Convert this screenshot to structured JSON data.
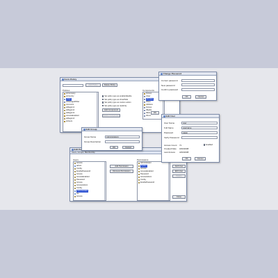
{
  "form_policy": {
    "title": "Form Policy",
    "buttons": {
      "add_policy": "Add Policy",
      "delete_policy": "Delete Policy",
      "add_component": "Add Component",
      "delete_component": "Delete Component",
      "ok": "OK",
      "cancel": "Cancel"
    },
    "policies_label": "Policies",
    "components_label": "Components",
    "policies": [
      "ieCompany",
      "ieCountry",
      "Users",
      "ieManagedFilter",
      "Accounts",
      "ieRegion1",
      "ieRegion2",
      "ieRegion3",
      "AccessEnabled",
      "ieRegion4",
      "ieUsers"
    ],
    "components": [
      "tGroup",
      "tUser",
      "tAccess",
      "tPass",
      "Address",
      "tGroup",
      "tRights",
      "tRole",
      "tPerm"
    ],
    "checkboxes": [
      "Set policy type as enable/disable",
      "Set policy type as show/hide",
      "Set policy type as custom action",
      "Set policy type as readonly"
    ]
  },
  "change_password": {
    "title": "Change Password",
    "fields": [
      "Current password",
      "New password",
      "Confirm password"
    ],
    "buttons": {
      "ok": "OK",
      "cancel": "Cancel"
    }
  },
  "edit_user": {
    "title": "Edit User",
    "labels": {
      "user_name": "User Name",
      "full_name": "Full Name",
      "password": "Password",
      "verify_password": "Verify Password",
      "access_count": "Access Count",
      "created_date": "Created Date",
      "last_access": "Last Access",
      "enabled": "Enabled"
    },
    "values": {
      "user_name": "user",
      "full_name": "username",
      "password": "●●●●",
      "verify_password": "",
      "access_count": "71",
      "created_date": "3/20/2008",
      "last_access": "4/20/2008"
    },
    "buttons": {
      "ok": "OK",
      "cancel": "Cancel"
    }
  },
  "edit_group": {
    "title": "Edit Group",
    "labels": {
      "group_name": "Group Name",
      "group_description": "Group Description"
    },
    "values": {
      "group_name": "Administrators",
      "group_description": ""
    },
    "buttons": {
      "ok": "OK",
      "cancel": "Cancel"
    }
  },
  "edit_permissions": {
    "title": "Edit Permissions",
    "tabs": "Users, Groups, Membership",
    "users_label": "Users",
    "permissions_label": "Permissions",
    "users": [
      "Access",
      "admin",
      "Config",
      "EnablePassword",
      "Access",
      "AccessEnabled",
      "Password",
      "Access",
      "AccessAdmin",
      "Config",
      "Administrator",
      "Ge",
      "Access"
    ],
    "permissions": [
      "Administrator",
      "System",
      "Access",
      "AccessEnabled",
      "Password",
      "AccessAdmin",
      "Config",
      "EnablePassword"
    ],
    "buttons": {
      "add_permission": "Add Permission",
      "remove_permission": "Remove Permission",
      "add_user": "Add User",
      "edit_user": "Edit User",
      "delete": "Delete",
      "close": "Close"
    }
  }
}
